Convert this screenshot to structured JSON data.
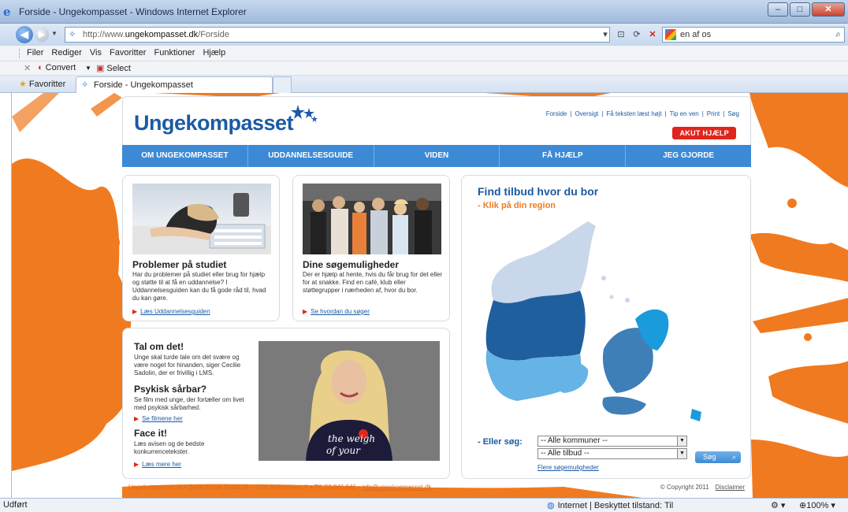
{
  "browser": {
    "title": "Forside - Ungekompasset - Windows Internet Explorer",
    "url_prefix": "http://www.",
    "url_domain": "ungekompasset.dk",
    "url_path": "/Forside",
    "search_text": "en af os",
    "menu": [
      "Filer",
      "Rediger",
      "Vis",
      "Favoritter",
      "Funktioner",
      "Hjælp"
    ],
    "command_bar": {
      "convert": "Convert",
      "select": "Select"
    },
    "favorites_label": "Favoritter",
    "tab_title": "Forside - Ungekompasset",
    "status": {
      "left": "Udført",
      "zone": "Internet | Beskyttet tilstand: Til",
      "zoom": "100%"
    }
  },
  "site": {
    "logo": "Ungekompasset",
    "toplinks": [
      "Forside",
      "Oversigt",
      "Få teksten læst højt",
      "Tip en ven",
      "Print",
      "Søg"
    ],
    "akut": "AKUT HJÆLP",
    "nav": [
      "OM UNGEKOMPASSET",
      "UDDANNELSESGUIDE",
      "VIDEN",
      "FÅ HJÆLP",
      "JEG GJORDE"
    ],
    "card1": {
      "title": "Problemer på studiet",
      "text": "Har du problemer på studiet eller brug for hjælp og støtte til at få en uddannelse? I Uddannelsesguiden kan du få gode råd til, hvad du kan gøre.",
      "link": "Læs Uddannelsesguiden"
    },
    "card2": {
      "title": "Dine søgemuligheder",
      "text": "Der er hjælp at hente, hvis du får brug for det eller for at snakke. Find en café, klub eller støttegrupper i nærheden af, hvor du bor.",
      "link": "Se hvordan du søger"
    },
    "card3": {
      "section1_title": "Tal om det!",
      "section1_text": "Unge skal turde tale om det svære og være noget for hinanden, siger Cecilie Sadolin, der er frivillig i LMS.",
      "section2_title": "Psykisk sårbar?",
      "section2_text": "Se film med unge, der fortæller om livet med psykisk sårbarhed.",
      "section2_link": "Se filmene her",
      "section3_title": "Face it!",
      "section3_text": "Læs avisen og de bedste konkurrencetekster.",
      "section3_link": "Læs mere her",
      "video_shirt_text_1": "the weigh",
      "video_shirt_text_2": "of your"
    },
    "map": {
      "title": "Find tilbud hvor du bor",
      "subtitle": "- Klik på din region",
      "search_label": "- Eller søg:",
      "select1": "-- Alle kommuner --",
      "select2": "-- Alle tilbud --",
      "button": "Søg",
      "more_link": "Flere søgemuligheder"
    },
    "footer": {
      "address": "Ungekompasset.dk  •  Sankt Annæ Plads 16  •  1250 København K  •  Tlf. 50 846 846  •",
      "email": "info@ungekompasset.dk",
      "copyright": "© Copyright 2011",
      "disclaimer": "Disclaimer"
    }
  },
  "colors": {
    "brand_blue": "#1b5aa5",
    "nav_blue": "#3c8ad6",
    "accent_orange": "#f07a1f",
    "alert_red": "#e0261c"
  }
}
